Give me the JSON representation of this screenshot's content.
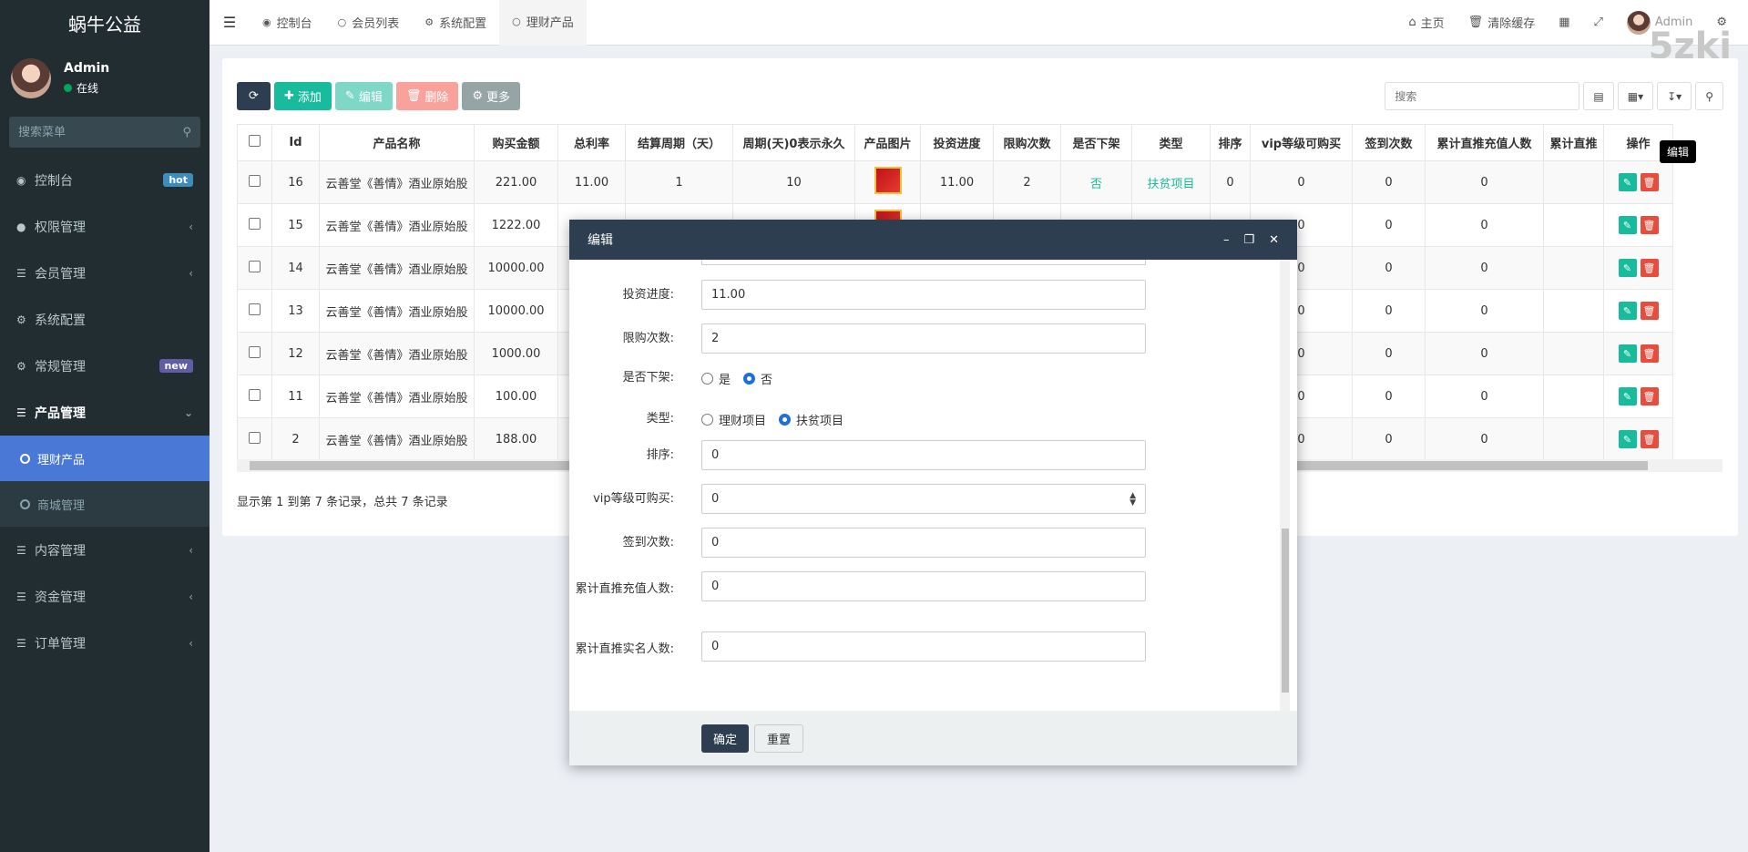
{
  "app": {
    "logo": "蜗牛公益",
    "corner_logo": "5zki"
  },
  "user": {
    "name": "Admin",
    "status": "在线"
  },
  "sidebar": {
    "search_placeholder": "搜索菜单",
    "items": [
      {
        "label": "控制台",
        "icon": "dashboard-icon",
        "badge": "hot"
      },
      {
        "label": "权限管理",
        "icon": "users-icon"
      },
      {
        "label": "会员管理",
        "icon": "list-icon"
      },
      {
        "label": "系统配置",
        "icon": "gear-icon"
      },
      {
        "label": "常规管理",
        "icon": "cogs-icon",
        "badge": "new"
      },
      {
        "label": "产品管理",
        "icon": "list-icon"
      }
    ],
    "subitems": [
      {
        "label": "理财产品"
      },
      {
        "label": "商城管理"
      }
    ],
    "items2": [
      {
        "label": "内容管理",
        "icon": "list-icon"
      },
      {
        "label": "资金管理",
        "icon": "list-icon"
      },
      {
        "label": "订单管理",
        "icon": "list-icon"
      }
    ]
  },
  "topbar": {
    "tabs": [
      "控制台",
      "会员列表",
      "系统配置",
      "理财产品"
    ],
    "home": "主页",
    "clear_cache": "清除缓存",
    "admin": "Admin"
  },
  "toolbar": {
    "add": "添加",
    "edit": "编辑",
    "delete": "删除",
    "more": "更多",
    "search_placeholder": "搜索"
  },
  "table": {
    "headers": [
      "Id",
      "产品名称",
      "购买金额",
      "总利率",
      "结算周期（天）",
      "周期(天)0表示永久",
      "产品图片",
      "投资进度",
      "限购次数",
      "是否下架",
      "类型",
      "排序",
      "vip等级可购买",
      "签到次数",
      "累计直推充值人数",
      "累计直推",
      "操作"
    ],
    "rows": [
      {
        "id": "16",
        "name": "云善堂《善情》酒业原始股",
        "amount": "221.00",
        "rate": "11.00",
        "settle": "1",
        "period": "10",
        "progress": "11.00",
        "limit": "2",
        "offline": "否",
        "type": "扶贫项目",
        "sort": "0",
        "vip": "0",
        "sign": "0",
        "recharge": "0"
      },
      {
        "id": "15",
        "name": "云善堂《善情》酒业原始股",
        "amount": "1222.00",
        "vip": "0",
        "sign": "0",
        "recharge": "0"
      },
      {
        "id": "14",
        "name": "云善堂《善情》酒业原始股",
        "amount": "10000.00",
        "vip": "0",
        "sign": "0",
        "recharge": "0"
      },
      {
        "id": "13",
        "name": "云善堂《善情》酒业原始股",
        "amount": "10000.00",
        "vip": "0",
        "sign": "0",
        "recharge": "0"
      },
      {
        "id": "12",
        "name": "云善堂《善情》酒业原始股",
        "amount": "1000.00",
        "vip": "0",
        "sign": "0",
        "recharge": "0"
      },
      {
        "id": "11",
        "name": "云善堂《善情》酒业原始股",
        "amount": "100.00",
        "vip": "0",
        "sign": "0",
        "recharge": "0"
      },
      {
        "id": "2",
        "name": "云善堂《善情》酒业原始股",
        "amount": "188.00",
        "vip": "0",
        "sign": "0",
        "recharge": "0"
      }
    ],
    "tooltip": "编辑",
    "pager": "显示第 1 到第 7 条记录，总共 7 条记录"
  },
  "modal": {
    "title": "编辑",
    "fields": {
      "progress_label": "投资进度:",
      "progress": "11.00",
      "limit_label": "限购次数:",
      "limit": "2",
      "offline_label": "是否下架:",
      "offline_yes": "是",
      "offline_no": "否",
      "type_label": "类型:",
      "type_a": "理财项目",
      "type_b": "扶贫项目",
      "sort_label": "排序:",
      "sort": "0",
      "vip_label": "vip等级可购买:",
      "vip": "0",
      "sign_label": "签到次数:",
      "sign": "0",
      "recharge_label": "累计直推充值人数:",
      "recharge": "0",
      "realname_label": "累计直推实名人数:",
      "realname": "0"
    },
    "ok": "确定",
    "reset": "重置"
  }
}
